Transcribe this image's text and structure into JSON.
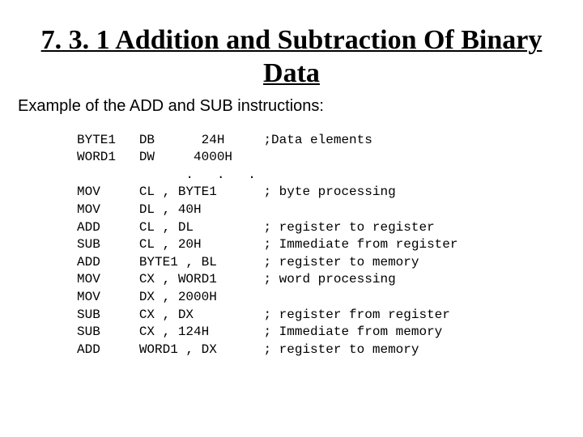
{
  "title": "7. 3. 1 Addition and Subtraction Of Binary Data",
  "subtitle": "Example of the ADD and SUB instructions:",
  "code": "BYTE1   DB      24H     ;Data elements\nWORD1   DW     4000H\n              .   .   .\nMOV     CL , BYTE1      ; byte processing\nMOV     DL , 40H\nADD     CL , DL         ; register to register\nSUB     CL , 20H        ; Immediate from register\nADD     BYTE1 , BL      ; register to memory\nMOV     CX , WORD1      ; word processing\nMOV     DX , 2000H\nSUB     CX , DX         ; register from register\nSUB     CX , 124H       ; Immediate from memory\nADD     WORD1 , DX      ; register to memory"
}
